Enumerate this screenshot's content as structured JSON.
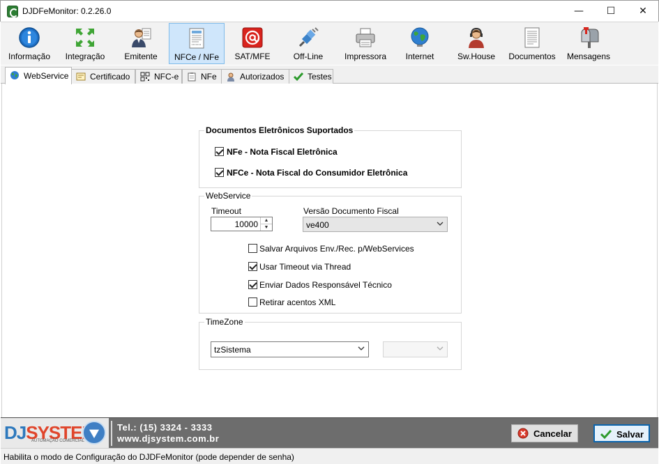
{
  "window": {
    "title": "DJDFeMonitor: 0.2.26.0",
    "minimize": "—",
    "maximize": "☐",
    "close": "✕"
  },
  "toolbar": {
    "items": [
      {
        "label": "Informação",
        "icon": "info-icon"
      },
      {
        "label": "Integração",
        "icon": "integration-arrows-icon"
      },
      {
        "label": "Emitente",
        "icon": "person-icon"
      },
      {
        "label": "NFCe / NFe",
        "icon": "receipt-icon",
        "active": true
      },
      {
        "label": "SAT/MFE",
        "icon": "at-sign-icon"
      },
      {
        "label": "Off-Line",
        "icon": "plug-icon"
      },
      {
        "label": "Impressora",
        "icon": "printer-icon"
      },
      {
        "label": "Internet",
        "icon": "globe-icon"
      },
      {
        "label": "Sw.House",
        "icon": "headset-person-icon"
      },
      {
        "label": "Documentos",
        "icon": "document-icon"
      },
      {
        "label": "Mensagens",
        "icon": "mailbox-icon"
      }
    ]
  },
  "tabs": [
    {
      "label": "WebService",
      "icon": "globe-icon",
      "active": true
    },
    {
      "label": "Certificado",
      "icon": "certificate-icon"
    },
    {
      "label": "NFC-e",
      "icon": "qrcode-icon"
    },
    {
      "label": "NFe",
      "icon": "clipboard-icon"
    },
    {
      "label": "Autorizados",
      "icon": "user-icon"
    },
    {
      "label": "Testes",
      "icon": "checkmark-icon"
    }
  ],
  "docs_group": {
    "legend": "Documentos Eletrônicos Suportados",
    "options": [
      {
        "label": "NFe - Nota Fiscal Eletrônica",
        "checked": true
      },
      {
        "label": "NFCe - Nota Fiscal do Consumidor Eletrônica",
        "checked": true
      }
    ]
  },
  "webservice_group": {
    "legend": "WebService",
    "timeout_label": "Timeout",
    "timeout_value": "10000",
    "version_label": "Versão Documento Fiscal",
    "version_value": "ve400",
    "options": [
      {
        "label": "Salvar Arquivos Env./Rec. p/WebServices",
        "checked": false
      },
      {
        "label": "Usar Timeout via Thread",
        "checked": true
      },
      {
        "label": "Enviar Dados Responsável Técnico",
        "checked": true
      },
      {
        "label": "Retirar acentos XML",
        "checked": false
      }
    ]
  },
  "timezone_group": {
    "legend": "TimeZone",
    "zone_value": "tzSistema",
    "offset_value": ""
  },
  "footer": {
    "logo_dj": "DJ",
    "logo_system": "SYSTEM",
    "logo_sub": "AUTOMAÇÃO COMERCIAL",
    "phone": "Tel.: (15) 3324 - 3333",
    "site": "www.djsystem.com.br",
    "cancel_label": "Cancelar",
    "save_label": "Salvar"
  },
  "status_bar": {
    "text": "Habilita o modo de Configuração do DJDFeMonitor (pode depender de senha)"
  },
  "colors": {
    "accent": "#0a64ad",
    "active_tool_bg": "#cfe6fb",
    "footer_bg": "#6d6d6d",
    "logo_blue": "#2e79bd",
    "logo_red": "#e0452b"
  }
}
